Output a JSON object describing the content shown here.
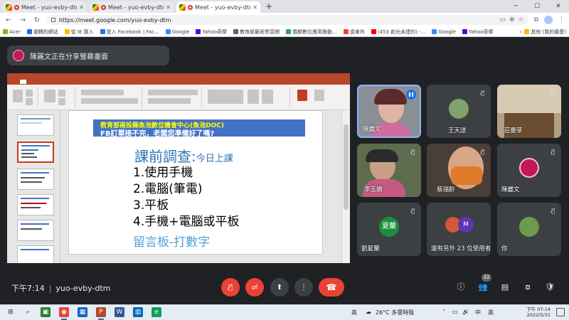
{
  "browser": {
    "tabs": [
      {
        "title": "Meet - yuo-evby-dtm",
        "active": false
      },
      {
        "title": "Meet - yuo-evby-dtm",
        "active": false
      },
      {
        "title": "Meet - yuo-evby-dtm",
        "active": true
      }
    ],
    "new_tab": "+",
    "url": "https://meet.google.com/yuo-evby-dtm",
    "bookmarks": [
      {
        "label": "Acer",
        "color": "#83b81a"
      },
      {
        "label": "運轉的網站",
        "color": "#1a73e8"
      },
      {
        "label": "從 IE 匯入",
        "color": "#fbbc04"
      },
      {
        "label": "登入 Facebook | Fac...",
        "color": "#1877f2"
      },
      {
        "label": "Google",
        "color": "#4285f4"
      },
      {
        "label": "Yahoo奇摩",
        "color": "#6001d2"
      },
      {
        "label": "教育部藝術學習網",
        "color": "#5f6368"
      },
      {
        "label": "僑都數位應用推動...",
        "color": "#34a853"
      },
      {
        "label": "遠東炸",
        "color": "#ea4335"
      },
      {
        "label": "(453 創光未建的) -...",
        "color": "#ff0000"
      },
      {
        "label": "Google",
        "color": "#4285f4"
      },
      {
        "label": "Yahoo奇摩",
        "color": "#6001d2"
      }
    ],
    "bookmarks_other": "其他 (我的最愛)"
  },
  "meet": {
    "presenting_banner": "陳麗文正在分享螢幕畫面",
    "meeting_time": "下午7:14",
    "meeting_code": "yuo-evby-dtm",
    "participant_count": "32",
    "participants": [
      {
        "name": "陳麗文",
        "type": "photo",
        "speaking": true
      },
      {
        "name": "王天送",
        "type": "avatar",
        "muted": true
      },
      {
        "name": "莊慶草",
        "type": "photo",
        "muted": true
      },
      {
        "name": "李玉嬌",
        "type": "photo",
        "muted": true
      },
      {
        "name": "蔡瑞齡",
        "type": "photo",
        "muted": true
      },
      {
        "name": "陳麗文",
        "type": "avatar",
        "muted": true
      },
      {
        "name": "劉夏蘭",
        "type": "letter",
        "letter": "夏蘭",
        "muted": true
      },
      {
        "name": "還有另外 23 位使用者",
        "type": "group",
        "letter": "M"
      },
      {
        "name": "你",
        "type": "avatar",
        "muted": true
      }
    ]
  },
  "slide": {
    "banner_line1": "教育部南投縣魚池數位機會中心(魚池DOC)",
    "banner_line2": "FB訂單接不完，老闆您準備好了嗎?",
    "heading_main": "課前調查:",
    "heading_sub": "今日上課",
    "items": [
      "1.使用手機",
      "2.電腦(筆電)",
      "3.平板",
      "4.手機+電腦或平板"
    ],
    "footer": "留言板-打數字"
  },
  "taskbar": {
    "weather": "26°C 多雲時陰",
    "ime": "英",
    "time": "下午 07:14",
    "date": "2022/5/31"
  }
}
